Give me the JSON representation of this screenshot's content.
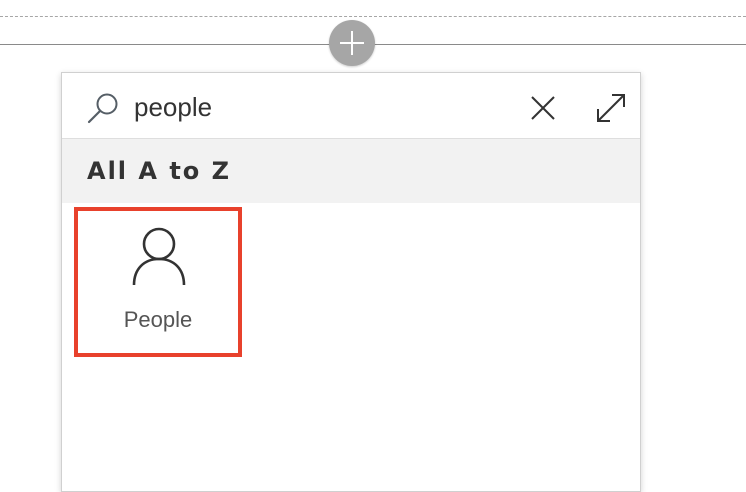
{
  "search": {
    "value": "people",
    "placeholder": ""
  },
  "section": {
    "header": "All A to Z"
  },
  "results": [
    {
      "label": "People",
      "icon": "person-icon",
      "selected": true
    }
  ],
  "colors": {
    "highlight_border": "#e8412c",
    "add_button": "#a6a6a6",
    "section_header_bg": "#f2f2f2"
  }
}
